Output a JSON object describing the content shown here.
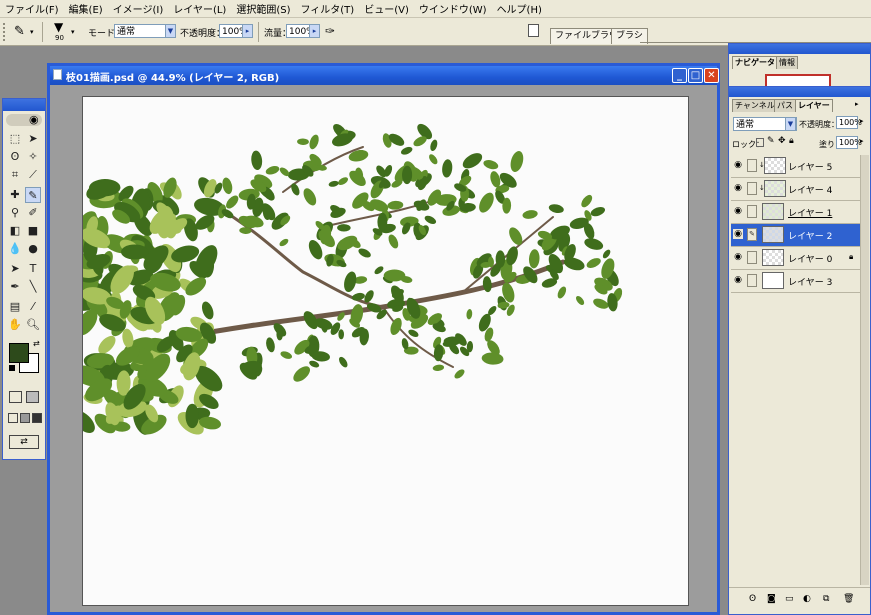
{
  "menu": [
    "ファイル(F)",
    "編集(E)",
    "イメージ(I)",
    "レイヤー(L)",
    "選択範囲(S)",
    "フィルタ(T)",
    "ビュー(V)",
    "ウインドウ(W)",
    "ヘルプ(H)"
  ],
  "options": {
    "brush_size": "90",
    "mode_label": "モード：",
    "mode_value": "通常",
    "opacity_label": "不透明度：",
    "opacity_value": "100%",
    "flow_label": "流量：",
    "flow_value": "100%"
  },
  "palette_well": {
    "tabs": [
      "ファイルブラウザ",
      "ブラシ"
    ]
  },
  "document": {
    "title": "枝01描画.psd @ 44.9% (レイヤー 2, RGB)"
  },
  "navigator": {
    "tabs": [
      "ナビゲータ",
      "情報"
    ]
  },
  "layers_palette": {
    "tabs": [
      "チャンネル",
      "パス",
      "レイヤー"
    ],
    "blend_mode": "通常",
    "opacity_label": "不透明度：",
    "opacity_value": "100%",
    "lock_label": "ロック：",
    "fill_label": "塗り：",
    "fill_value": "100%",
    "layers": [
      {
        "name": "レイヤー 5",
        "selected": false,
        "clipped": true
      },
      {
        "name": "レイヤー 4",
        "selected": false,
        "clipped": true
      },
      {
        "name": "レイヤー 1",
        "selected": false,
        "clipped": false
      },
      {
        "name": "レイヤー 2",
        "selected": true,
        "clipped": false
      },
      {
        "name": "レイヤー 0",
        "selected": false,
        "clipped": false
      },
      {
        "name": "レイヤー 3",
        "selected": false,
        "clipped": false
      }
    ]
  },
  "colors": {
    "xp_blue": "#2a5bd6",
    "selection": "#2f62d0",
    "foreground": "#2d4a1b",
    "background": "#ffffff",
    "leaf_dark": "#3f6d1c",
    "leaf_mid": "#5f8f2a",
    "leaf_light": "#a8c25a",
    "branch": "#6e5a48"
  }
}
